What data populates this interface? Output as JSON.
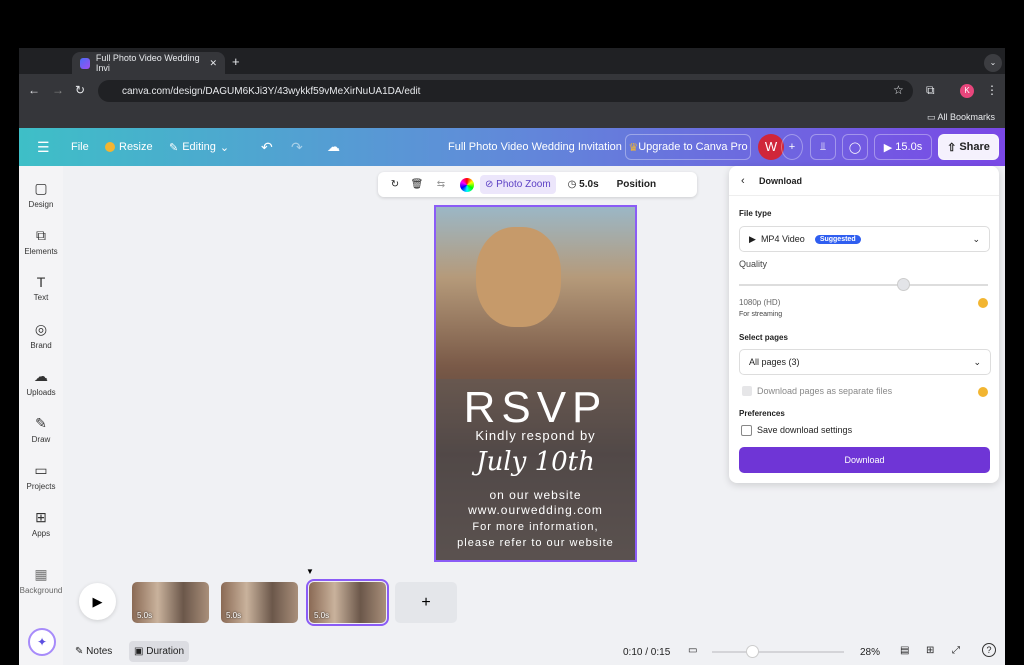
{
  "browser": {
    "tab_title": "Full Photo Video Wedding Invi",
    "url": "canva.com/design/DAGUM6KJi3Y/43wykkf59vMeXirNuUA1DA/edit",
    "bookmarks": "All Bookmarks",
    "profile": "K"
  },
  "header": {
    "file": "File",
    "resize": "Resize",
    "editing": "Editing",
    "title": "Full Photo Video Wedding Invitation",
    "upgrade": "Upgrade to Canva Pro",
    "avatar": "W",
    "play_time": "15.0s",
    "share": "Share"
  },
  "sidebar": {
    "items": [
      {
        "label": "Design",
        "icon": "▢"
      },
      {
        "label": "Elements",
        "icon": "⧉"
      },
      {
        "label": "Text",
        "icon": "T"
      },
      {
        "label": "Brand",
        "icon": "◎"
      },
      {
        "label": "Uploads",
        "icon": "☁"
      },
      {
        "label": "Draw",
        "icon": "✎"
      },
      {
        "label": "Projects",
        "icon": "▭"
      },
      {
        "label": "Apps",
        "icon": "⊞"
      },
      {
        "label": "Background",
        "icon": "▦"
      }
    ]
  },
  "toolbar": {
    "photo_zoom": "Photo Zoom",
    "duration": "5.0s",
    "position": "Position"
  },
  "design": {
    "rsvp": "RSVP",
    "line1": "Kindly respond by",
    "date": "July 10th",
    "line2": "on our website",
    "line3": "www.ourwedding.com",
    "line4": "For more information,",
    "line5": "please refer to our website"
  },
  "download": {
    "title": "Download",
    "file_type_label": "File type",
    "file_type": "MP4 Video",
    "suggested": "Suggested",
    "quality_label": "Quality",
    "quality_value_fraction": 0.66,
    "quality": "1080p (HD)",
    "quality_sub": "For streaming",
    "pages_label": "Select pages",
    "pages": "All pages (3)",
    "separate": "Download pages as separate files",
    "separate_checked": false,
    "prefs_label": "Preferences",
    "save_settings": "Save download settings",
    "save_checked": false,
    "button": "Download"
  },
  "timeline": {
    "pages": [
      {
        "duration": "5.0s"
      },
      {
        "duration": "5.0s"
      },
      {
        "duration": "5.0s",
        "selected": true
      }
    ],
    "add": "+"
  },
  "footer": {
    "notes": "Notes",
    "duration": "Duration",
    "time": "0:10 / 0:15",
    "zoom": "28%",
    "zoom_fraction": 0.3
  },
  "colors": {
    "accent": "#6f35d6",
    "suggested": "#2f5ef0",
    "crown": "#f2b531"
  }
}
